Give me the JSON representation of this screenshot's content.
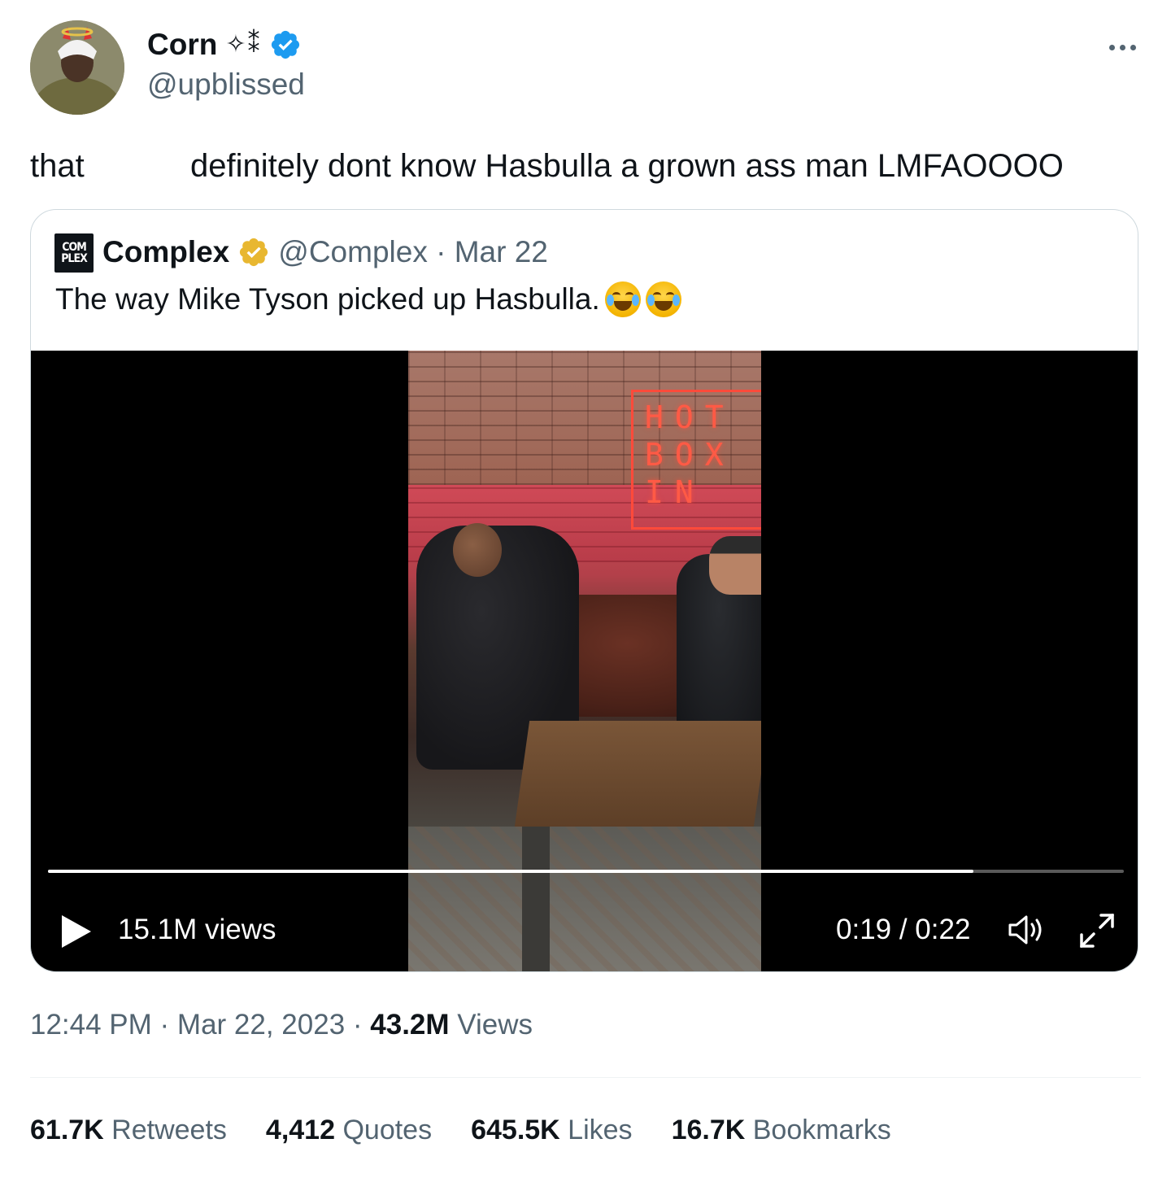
{
  "author": {
    "display_name": "Corn",
    "name_decoration": "✧⁑",
    "handle": "@upblissed",
    "verified_color": "#1d9bf0"
  },
  "tweet": {
    "text_part1": "that",
    "text_part2": "definitely dont know Hasbulla a grown ass man LMFAOOOO"
  },
  "quoted": {
    "logo_text_top": "COM",
    "logo_text_bottom": "PLEX",
    "name": "Complex",
    "verified_color": "#e8b730",
    "meta": "@Complex · Mar 22",
    "text": "The way Mike Tyson picked up Hasbulla.",
    "emoji": [
      "face-with-tears-of-joy",
      "face-with-tears-of-joy"
    ],
    "video": {
      "neon_sign": [
        "HOT",
        "BOX",
        "IN"
      ],
      "views": "15.1M views",
      "time": "0:19 / 0:22",
      "progress": 0.86
    }
  },
  "meta": {
    "time": "12:44 PM",
    "separator": " · ",
    "date": "Mar 22, 2023",
    "views_count": "43.2M",
    "views_label": " Views"
  },
  "stats": [
    {
      "count": "61.7K",
      "label": " Retweets"
    },
    {
      "count": "4,412",
      "label": " Quotes"
    },
    {
      "count": "645.5K",
      "label": " Likes"
    },
    {
      "count": "16.7K",
      "label": " Bookmarks"
    }
  ],
  "icons": {
    "more": "more-horizontal-icon",
    "verified": "verified-badge-icon",
    "play": "play-icon",
    "volume": "volume-icon",
    "fullscreen": "fullscreen-icon"
  }
}
